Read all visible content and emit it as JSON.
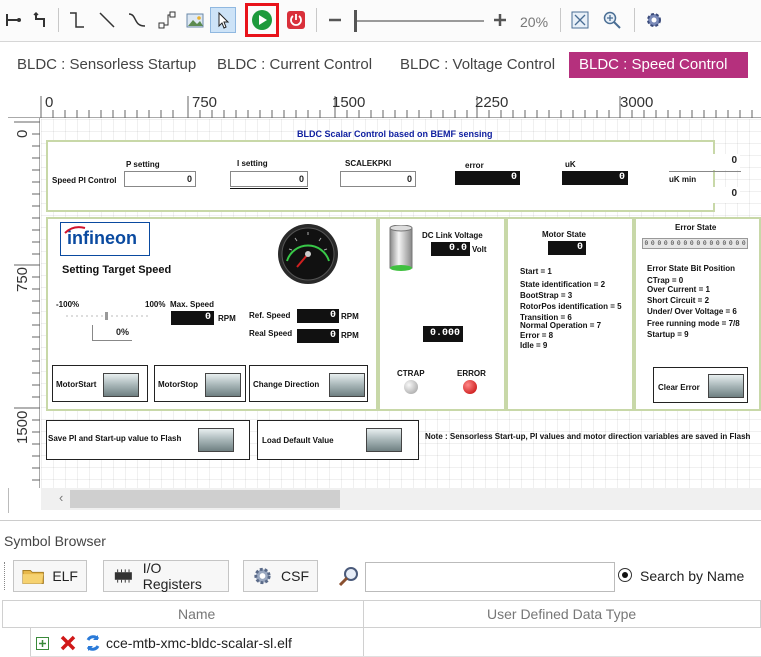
{
  "toolbar": {
    "zoom_percent": "20%"
  },
  "tabs": [
    {
      "label": "BLDC : Sensorless Startup"
    },
    {
      "label": "BLDC : Current  Control"
    },
    {
      "label": "BLDC : Voltage Control"
    },
    {
      "label": "BLDC : Speed Control"
    }
  ],
  "ruler": {
    "h": [
      "0",
      "750",
      "1500",
      "2250",
      "3000"
    ],
    "v": [
      "0",
      "750",
      "1500"
    ]
  },
  "canvas": {
    "title": "BLDC Scalar Control based on BEMF sensing",
    "speed_pi": {
      "label": "Speed PI Control",
      "p_setting_label": "P setting",
      "p_setting_value": "0",
      "i_setting_label": "I setting",
      "i_setting_value": "0",
      "scalekpki_label": "SCALEKPKI",
      "scalekpki_value": "0",
      "error_label": "error",
      "error_value": "0",
      "uk_label": "uK",
      "uk_value": "0",
      "uk_max_value": "0",
      "uk_min_label": "uK  min",
      "uk_min_value": "0"
    },
    "target": {
      "logo_text": "infineon",
      "title": "Setting Target Speed",
      "neg_100": "-100%",
      "pos_100": "100%",
      "max_speed_label": "Max. Speed",
      "max_speed_value": "0",
      "rpm1": "RPM",
      "slider_value": "0%",
      "ref_speed_label": "Ref. Speed",
      "ref_speed_value": "0",
      "rpm2": "RPM",
      "real_speed_label": "Real Speed",
      "real_speed_value": "0",
      "rpm3": "RPM",
      "motor_start": "MotorStart",
      "motor_stop": "MotorStop",
      "change_direction": "Change Direction"
    },
    "dc_link": {
      "label": "DC Link Voltage",
      "value": "0.0",
      "unit": "Volt",
      "secondary_value": "0.000",
      "ctrap_label": "CTRAP",
      "error_label": "ERROR"
    },
    "motor_state": {
      "title": "Motor State",
      "value": "0",
      "lines": [
        "Start = 1",
        "State identification = 2",
        "BootStrap = 3",
        "RotorPos identification = 5",
        "Transition = 6",
        "Normal Operation = 7",
        "Error = 8",
        "Idle = 9"
      ]
    },
    "error_state": {
      "title": "Error State",
      "bits": [
        "0",
        "0",
        "0",
        "0",
        "0",
        "0",
        "0",
        "0",
        "0",
        "0",
        "0",
        "0",
        "0",
        "0",
        "0",
        "0"
      ],
      "bit_position_title": "Error State Bit Position",
      "lines": [
        "CTrap = 0",
        "Over Current = 1",
        "Short Circuit = 2",
        "Under/ Over Voltage = 6",
        "Free running mode = 7/8",
        "Startup = 9"
      ],
      "clear_error": "Clear Error"
    },
    "bottom": {
      "save_label": "Save PI and Start-up value to Flash",
      "load_default": "Load Default Value",
      "note": "Note : Sensorless Start-up,  PI values and motor direction variables are saved in Flash"
    }
  },
  "symbol_browser": {
    "title": "Symbol Browser",
    "elf_label": "ELF",
    "io_label": "I/O Registers",
    "csf_label": "CSF",
    "search_placeholder": "",
    "search_mode_label": "Search by Name",
    "col_name": "Name",
    "col_type": "User Defined Data Type",
    "rows": [
      {
        "name": "cce-mtb-xmc-bldc-scalar-sl.elf"
      }
    ]
  }
}
